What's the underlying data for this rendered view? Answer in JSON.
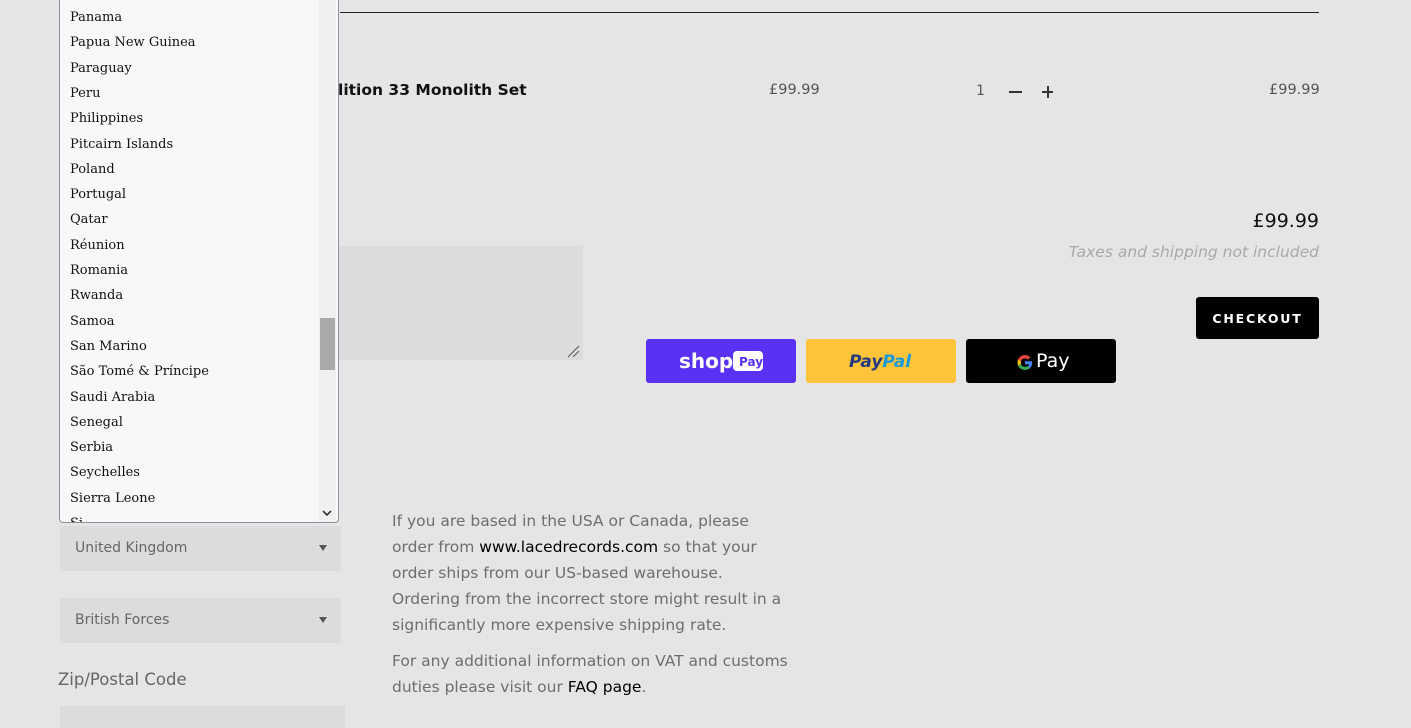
{
  "cart": {
    "product_title": "lition 33 Monolith Set",
    "unit_price": "£99.99",
    "quantity": "1",
    "line_total": "£99.99"
  },
  "totals": {
    "subtotal": "£99.99",
    "tax_note": "Taxes and shipping not included",
    "checkout_label": "CHECKOUT"
  },
  "payments": {
    "shop_pay": "shop",
    "shop_pay_badge": "Pay",
    "paypal_a": "Pay",
    "paypal_b": "Pal",
    "gpay": "Pay",
    "colors": {
      "shop_pay": "#5a31f4",
      "paypal": "#ffc439",
      "gpay": "#000000"
    }
  },
  "info": {
    "p1_a": "If you are based in the USA or Canada, please order from ",
    "p1_link": "www.lacedrecords.com",
    "p1_b": " so that your order ships from our US-based warehouse. Ordering from the incorrect store might result in a significantly more expensive shipping rate.",
    "p2_a": "For any additional information on VAT and customs duties please visit our ",
    "p2_link": "FAQ page",
    "p2_b": "."
  },
  "address": {
    "country_selected": "United Kingdom",
    "province_selected": "British Forces",
    "zip_label": "Zip/Postal Code"
  },
  "dropdown": {
    "options": [
      "Panama",
      "Papua New Guinea",
      "Paraguay",
      "Peru",
      "Philippines",
      "Pitcairn Islands",
      "Poland",
      "Portugal",
      "Qatar",
      "Réunion",
      "Romania",
      "Rwanda",
      "Samoa",
      "San Marino",
      "São Tomé & Príncipe",
      "Saudi Arabia",
      "Senegal",
      "Serbia",
      "Seychelles",
      "Sierra Leone",
      "Si"
    ]
  }
}
